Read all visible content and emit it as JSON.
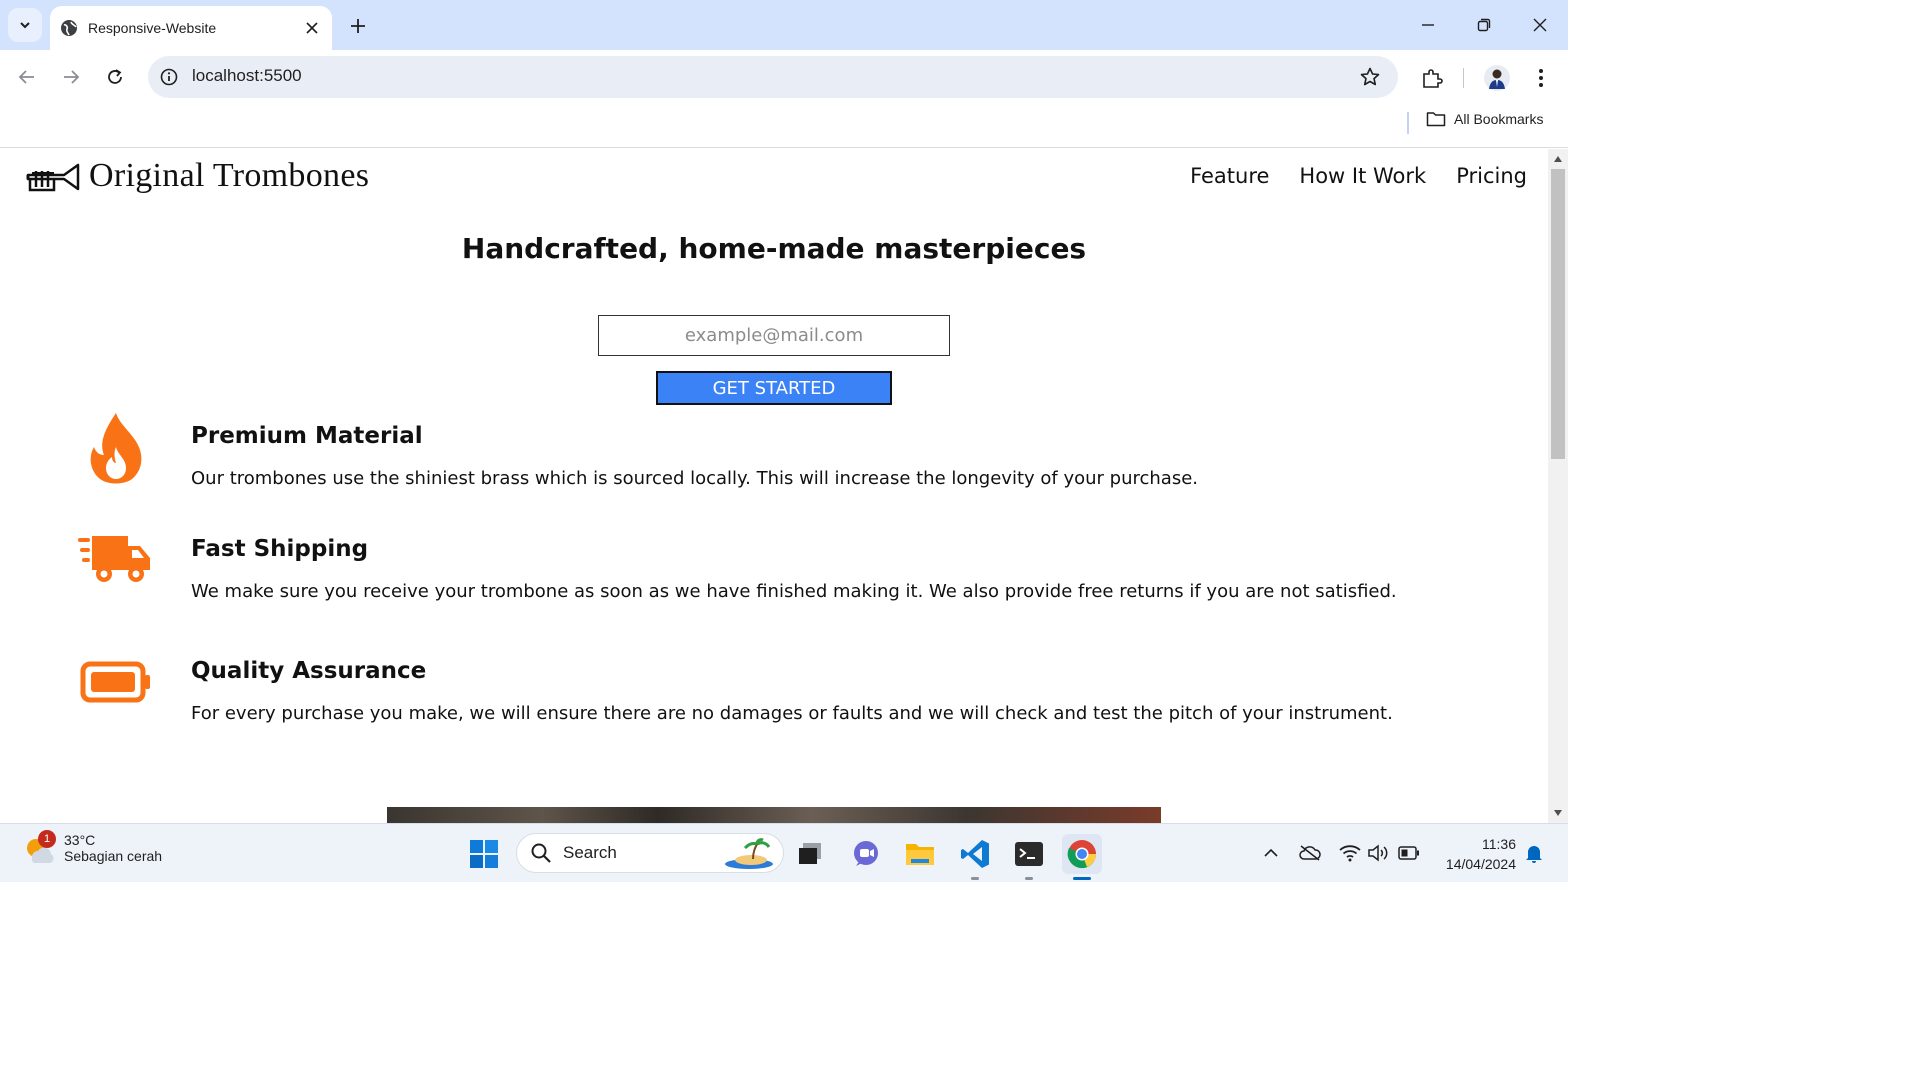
{
  "browser": {
    "tab_title": "Responsive-Website",
    "url": "localhost:5500",
    "bookmarks_label": "All Bookmarks"
  },
  "site": {
    "title": "Original Trombones",
    "nav": [
      "Feature",
      "How It Work",
      "Pricing"
    ],
    "hero_title": "Handcrafted, home-made masterpieces",
    "email_placeholder": "example@mail.com",
    "cta_label": "GET STARTED",
    "accent_color": "#f97316",
    "button_color": "#3b82f6",
    "features": [
      {
        "icon": "fire-icon",
        "title": "Premium Material",
        "text": "Our trombones use the shiniest brass which is sourced locally. This will increase the longevity of your purchase."
      },
      {
        "icon": "truck-icon",
        "title": "Fast Shipping",
        "text": "We make sure you receive your trombone as soon as we have finished making it. We also provide free returns if you are not satisfied."
      },
      {
        "icon": "battery-icon",
        "title": "Quality Assurance",
        "text": "For every purchase you make, we will ensure there are no damages or faults and we will check and test the pitch of your instrument."
      }
    ]
  },
  "taskbar": {
    "weather_temp": "33°C",
    "weather_condition": "Sebagian cerah",
    "weather_badge": "1",
    "search_label": "Search",
    "time": "11:36",
    "date": "14/04/2024"
  }
}
